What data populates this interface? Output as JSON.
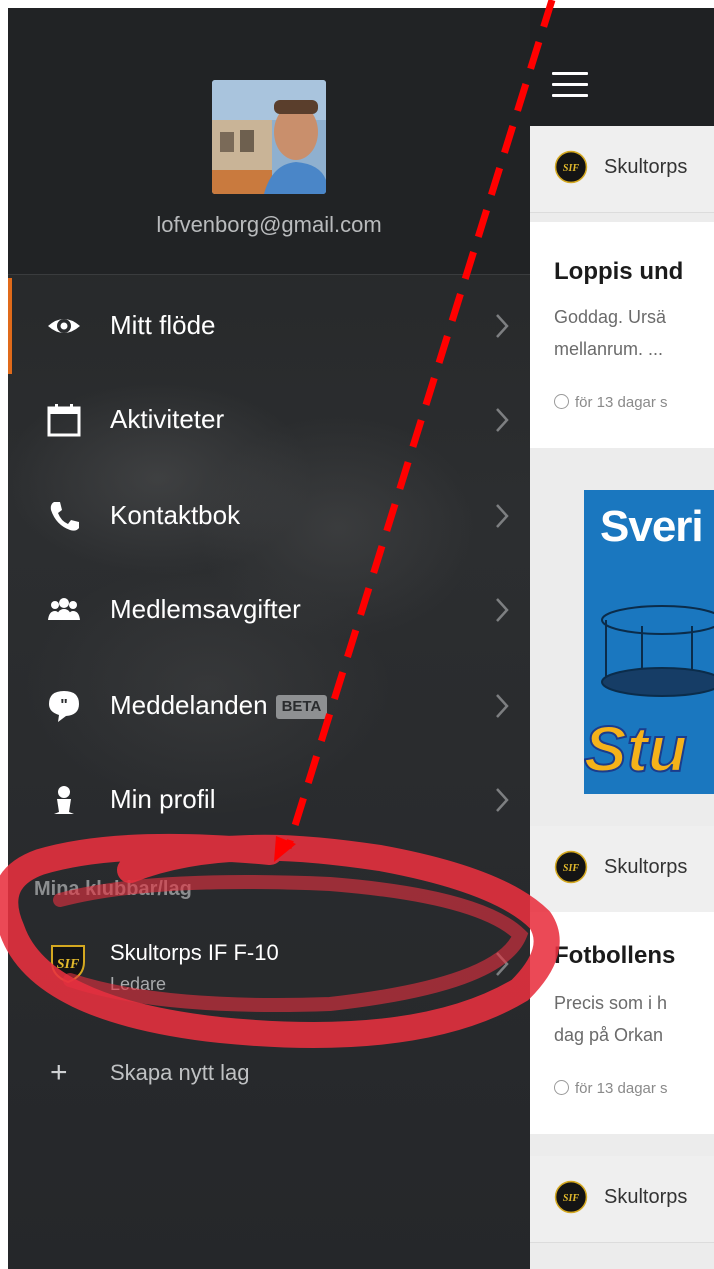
{
  "drawer": {
    "email": "lofvenborg@gmail.com",
    "menu": [
      {
        "label": "Mitt flöde",
        "icon": "eye-icon"
      },
      {
        "label": "Aktiviteter",
        "icon": "calendar-icon"
      },
      {
        "label": "Kontaktbok",
        "icon": "phone-icon"
      },
      {
        "label": "Medlemsavgifter",
        "icon": "people-icon"
      },
      {
        "label": "Meddelanden",
        "icon": "chat-bubble-icon",
        "badge": "BETA"
      },
      {
        "label": "Min profil",
        "icon": "person-icon"
      }
    ],
    "section_title": "Mina klubbar/lag",
    "club": {
      "name": "Skultorps IF F-10",
      "role": "Ledare"
    },
    "create_label": "Skapa nytt lag",
    "accent_color": "#e06a1a"
  },
  "feed": {
    "club_name": "Skultorps",
    "posts": [
      {
        "title": "Loppis und",
        "excerpt1": "Goddag. Ursä",
        "excerpt2": "mellanrum. ...",
        "time": "för 13 dagar s"
      },
      {
        "title": "Fotbollens",
        "excerpt1": "Precis som i h",
        "excerpt2": "dag på Orkan",
        "time": "för 13 dagar s"
      }
    ],
    "ad": {
      "headline": "Sveri",
      "footer": "Stu"
    }
  },
  "annotations": {
    "arrow_color": "#ff0000",
    "circle_color": "#e8303f"
  }
}
